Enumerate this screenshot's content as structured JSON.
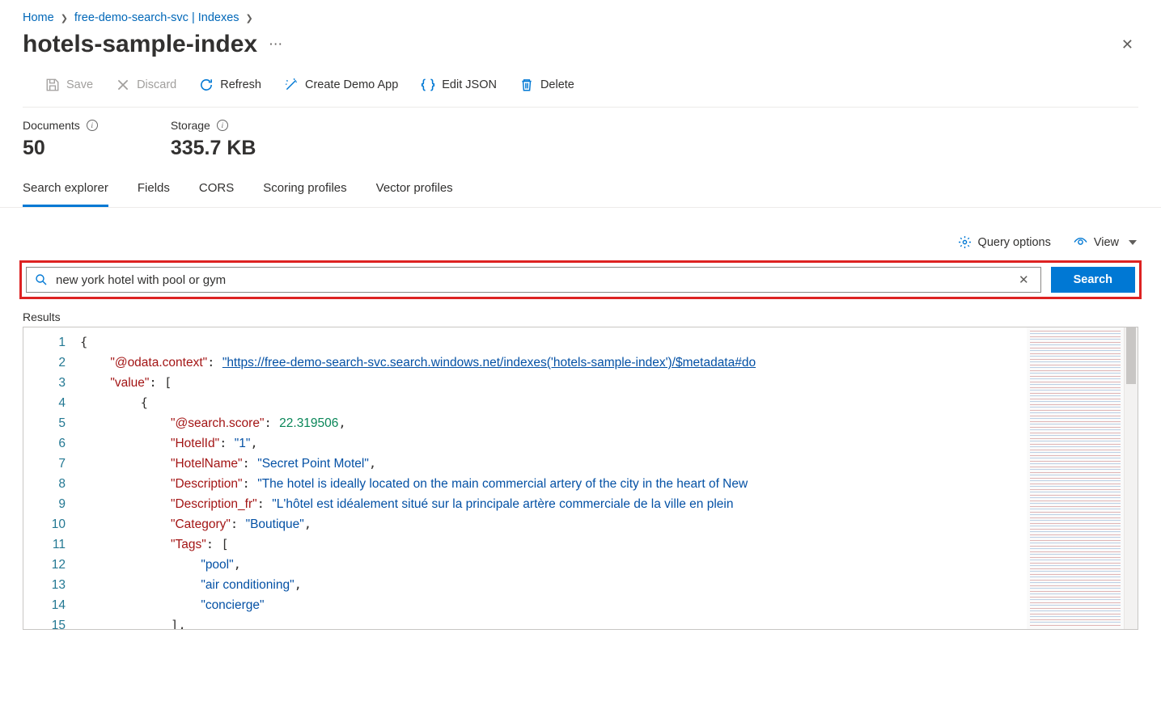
{
  "breadcrumb": {
    "home": "Home",
    "service": "free-demo-search-svc | Indexes"
  },
  "pageTitle": "hotels-sample-index",
  "toolbar": {
    "save": "Save",
    "discard": "Discard",
    "refresh": "Refresh",
    "createDemo": "Create Demo App",
    "editJson": "Edit JSON",
    "delete": "Delete"
  },
  "stats": {
    "docsLabel": "Documents",
    "docsValue": "50",
    "storageLabel": "Storage",
    "storageValue": "335.7 KB"
  },
  "tabs": {
    "searchExplorer": "Search explorer",
    "fields": "Fields",
    "cors": "CORS",
    "scoring": "Scoring profiles",
    "vector": "Vector profiles"
  },
  "options": {
    "query": "Query options",
    "view": "View"
  },
  "search": {
    "value": "new york hotel with pool or gym",
    "button": "Search"
  },
  "results": {
    "label": "Results",
    "lines": [
      "1",
      "2",
      "3",
      "4",
      "5",
      "6",
      "7",
      "8",
      "9",
      "10",
      "11",
      "12",
      "13",
      "14",
      "15"
    ],
    "json": {
      "context_key": "\"@odata.context\"",
      "context_url": "\"https://free-demo-search-svc.search.windows.net/indexes('hotels-sample-index')/$metadata#do",
      "value_key": "\"value\"",
      "score_key": "\"@search.score\"",
      "score_val": "22.319506",
      "hotelId_key": "\"HotelId\"",
      "hotelId_val": "\"1\"",
      "hotelName_key": "\"HotelName\"",
      "hotelName_val": "\"Secret Point Motel\"",
      "desc_key": "\"Description\"",
      "desc_val": "\"The hotel is ideally located on the main commercial artery of the city in the heart of New",
      "descfr_key": "\"Description_fr\"",
      "descfr_val": "\"L'hôtel est idéalement situé sur la principale artère commerciale de la ville en plein",
      "cat_key": "\"Category\"",
      "cat_val": "\"Boutique\"",
      "tags_key": "\"Tags\"",
      "tag1": "\"pool\"",
      "tag2": "\"air conditioning\"",
      "tag3": "\"concierge\""
    }
  }
}
